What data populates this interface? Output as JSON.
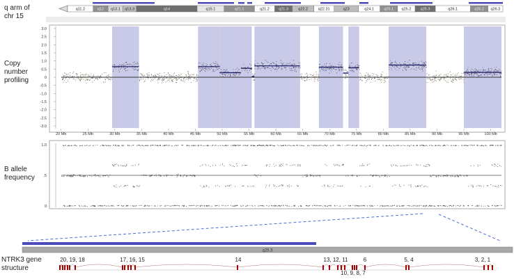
{
  "labels": {
    "chr_arm": "q arm of chr 15",
    "cnv": "Copy number profiling",
    "baf": "B allele frequency",
    "gene": "NTRK3 gene structure",
    "gene_band": "q25.3"
  },
  "chart_data": [
    {
      "type": "ideogram",
      "bands": [
        "q11.2",
        "q12",
        "q13.1",
        "q13.3",
        "q14",
        "q15.1",
        "q21.1",
        "q21.2",
        "q21.3",
        "q22.2",
        "q22.31",
        "q23",
        "q24.1",
        "q25.1",
        "q25.2",
        "q25.3",
        "q26.1",
        "q26.2",
        "q26.3"
      ],
      "band_shades": [
        "#ffffff",
        "#8f8f8f",
        "#d6d6d6",
        "#bdbdbd",
        "#6e6e6e",
        "#e6e6e6",
        "#8f8f8f",
        "#ffffff",
        "#6e6e6e",
        "#bdbdbd",
        "#ffffff",
        "#bdbdbd",
        "#ffffff",
        "#8f8f8f",
        "#ffffff",
        "#6e6e6e",
        "#ffffff",
        "#8f8f8f",
        "#ffffff"
      ],
      "marker_color": "#4a4ab8"
    },
    {
      "type": "scatter",
      "x_ticks": [
        "20 Mb",
        "25 Mb",
        "30 Mb",
        "35 Mb",
        "40 Mb",
        "45 Mb",
        "50 Mb",
        "55 Mb",
        "60 Mb",
        "65 Mb",
        "70 Mb",
        "75 Mb",
        "80 Mb",
        "85 Mb",
        "90 Mb",
        "95 Mb",
        "100 Mb"
      ],
      "y_ticks": [
        "3.0",
        "2.5",
        "2.0",
        "1.5",
        "1.0",
        "0.5",
        "0",
        "-0.5",
        "-1.0",
        "-1.5",
        "-2.0",
        "-2.5",
        "-3.0"
      ],
      "xlim": [
        19,
        102
      ],
      "ylim": [
        -3,
        3
      ],
      "gain_regions_mb": [
        [
          29.5,
          34.5
        ],
        [
          45.5,
          49.5
        ],
        [
          49.5,
          53.5
        ],
        [
          53.5,
          55.5
        ],
        [
          56,
          64.5
        ],
        [
          68,
          72.5
        ],
        [
          73.5,
          75.5
        ],
        [
          81,
          88
        ],
        [
          95,
          102
        ]
      ],
      "segments": [
        {
          "x": [
            20,
            29.5
          ],
          "y": 0.0
        },
        {
          "x": [
            29.5,
            34.5
          ],
          "y": 0.65
        },
        {
          "x": [
            34.5,
            45.5
          ],
          "y": 0.0
        },
        {
          "x": [
            45.5,
            49.5
          ],
          "y": 0.65
        },
        {
          "x": [
            49.5,
            53.5
          ],
          "y": 0.28
        },
        {
          "x": [
            53.5,
            55.5
          ],
          "y": 0.55
        },
        {
          "x": [
            55.5,
            56
          ],
          "y": 0.05
        },
        {
          "x": [
            56,
            64.5
          ],
          "y": 0.7
        },
        {
          "x": [
            64.5,
            68
          ],
          "y": 0.0
        },
        {
          "x": [
            68,
            72.5
          ],
          "y": 0.62
        },
        {
          "x": [
            72.5,
            73.5
          ],
          "y": 0.25
        },
        {
          "x": [
            73.5,
            75.5
          ],
          "y": 0.58
        },
        {
          "x": [
            75.5,
            81
          ],
          "y": 0.0
        },
        {
          "x": [
            81,
            88
          ],
          "y": 0.75
        },
        {
          "x": [
            88,
            95
          ],
          "y": 0.0
        },
        {
          "x": [
            95,
            102
          ],
          "y": 0.3
        }
      ],
      "colors": {
        "gain": "#c9c9e8",
        "segment": "#1a1a5e",
        "baseline": "#333333",
        "points": "#555555"
      }
    },
    {
      "type": "scatter",
      "y_ticks": [
        "1.0",
        ".5",
        "0"
      ],
      "ylim": [
        0,
        1
      ],
      "bands": [
        0,
        0.33,
        0.5,
        0.67,
        1
      ]
    },
    {
      "type": "gene-structure",
      "exon_labels": [
        "20, 19, 18",
        "17, 16, 15",
        "14",
        "13, 12, 11",
        "10, 9, 8, 7",
        "6",
        "5, 4",
        "3, 2, 1"
      ],
      "exon_color": "#a00000"
    }
  ]
}
